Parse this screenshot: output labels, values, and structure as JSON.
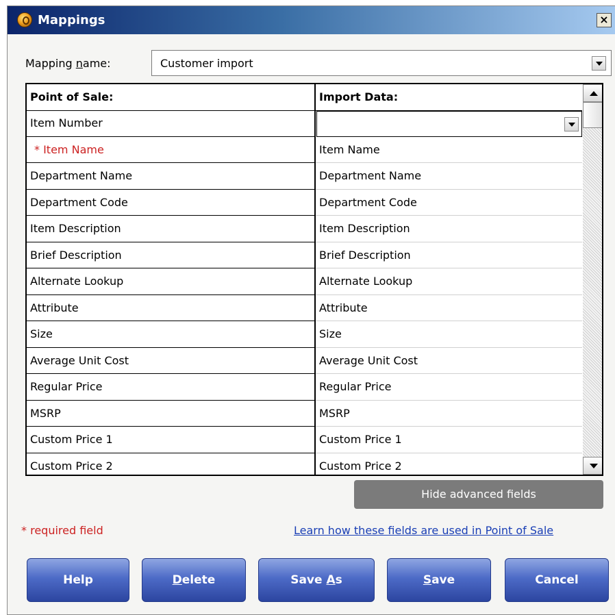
{
  "window": {
    "title": "Mappings",
    "close_label": "×"
  },
  "mapping": {
    "label_pre": "Mapping ",
    "label_access": "n",
    "label_post": "ame:",
    "value": "Customer import"
  },
  "grid": {
    "headers": {
      "left": "Point of Sale:",
      "right": "Import Data:"
    },
    "rows": [
      {
        "pos": "Item Number",
        "import": ""
      },
      {
        "pos": "* Item Name",
        "import": "Item Name"
      },
      {
        "pos": "Department Name",
        "import": "Department Name"
      },
      {
        "pos": "Department Code",
        "import": "Department Code"
      },
      {
        "pos": "Item Description",
        "import": "Item Description"
      },
      {
        "pos": "Brief Description",
        "import": "Brief Description"
      },
      {
        "pos": "Alternate Lookup",
        "import": "Alternate Lookup"
      },
      {
        "pos": "Attribute",
        "import": "Attribute"
      },
      {
        "pos": "Size",
        "import": "Size"
      },
      {
        "pos": "Average Unit Cost",
        "import": "Average Unit Cost"
      },
      {
        "pos": "Regular Price",
        "import": "Regular Price"
      },
      {
        "pos": "MSRP",
        "import": "MSRP"
      },
      {
        "pos": "Custom Price 1",
        "import": "Custom Price 1"
      },
      {
        "pos": "Custom Price 2",
        "import": "Custom Price 2"
      }
    ]
  },
  "hide_advanced_label": "Hide advanced fields",
  "required_note": "* required field",
  "learn_link": "Learn how these fields are used in Point of Sale",
  "buttons": {
    "help": {
      "pre": "Help",
      "u": "",
      "post": ""
    },
    "delete": {
      "pre": "",
      "u": "D",
      "post": "elete"
    },
    "save_as": {
      "pre": "Save ",
      "u": "A",
      "post": "s"
    },
    "save": {
      "pre": "",
      "u": "S",
      "post": "ave"
    },
    "cancel": {
      "pre": "Cancel",
      "u": "",
      "post": ""
    }
  },
  "colors": {
    "required": "#cc2222",
    "link": "#1a3fb5",
    "button": "#4d6bc7",
    "titlebar": "#0b246a"
  }
}
